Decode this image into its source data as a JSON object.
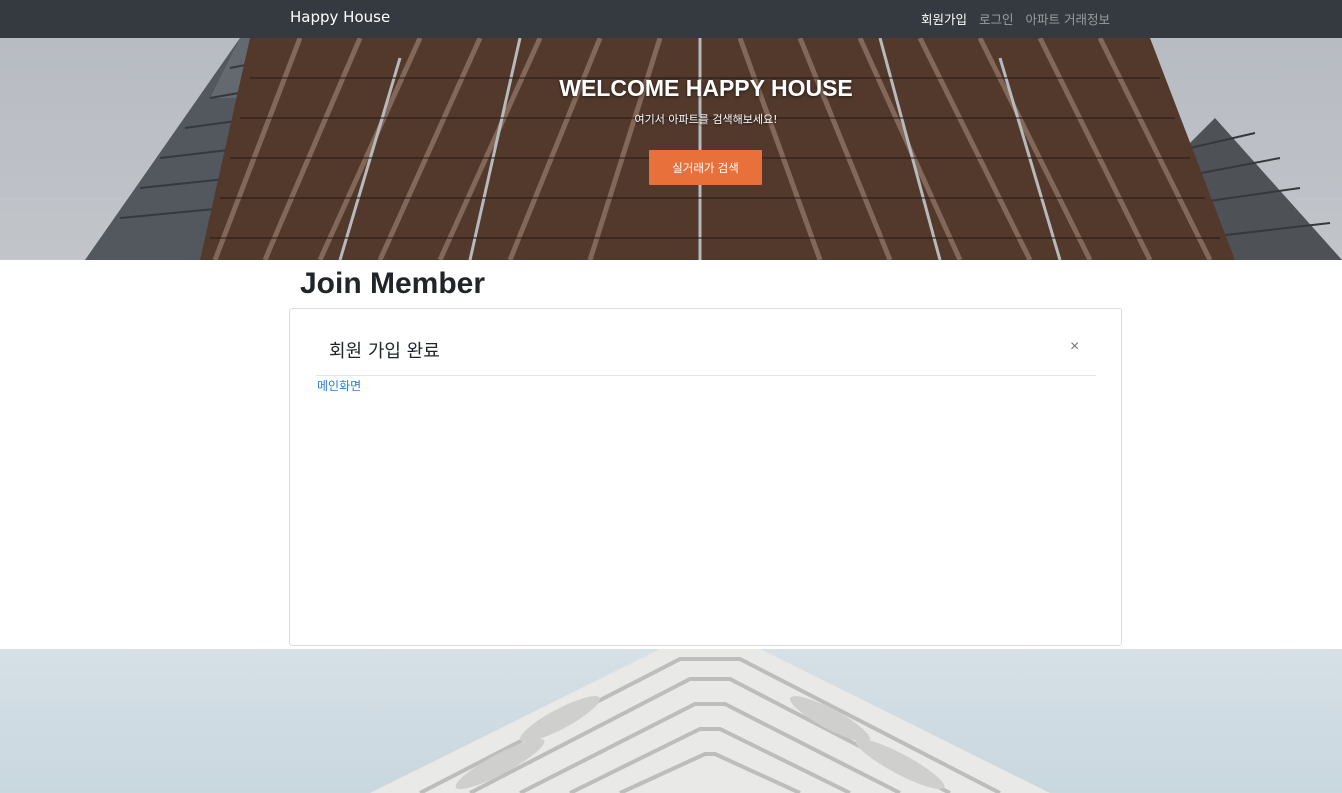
{
  "navbar": {
    "brand": "Happy House",
    "links": [
      {
        "label": "회원가입",
        "active": true
      },
      {
        "label": "로그인",
        "active": false
      },
      {
        "label": "아파트 거래정보",
        "active": false
      }
    ]
  },
  "hero": {
    "title": "WELCOME HAPPY HOUSE",
    "subtitle": "여기서 아파트를 검색해보세요!",
    "button_label": "실거래가 검색",
    "button_color": "#e8703a"
  },
  "section": {
    "title": "Join Member"
  },
  "card": {
    "title": "회원 가입 완료",
    "close_label": "×",
    "link_label": "메인화면",
    "link_color": "#2a7bd6"
  },
  "colors": {
    "navbar_bg": "#343a40"
  }
}
